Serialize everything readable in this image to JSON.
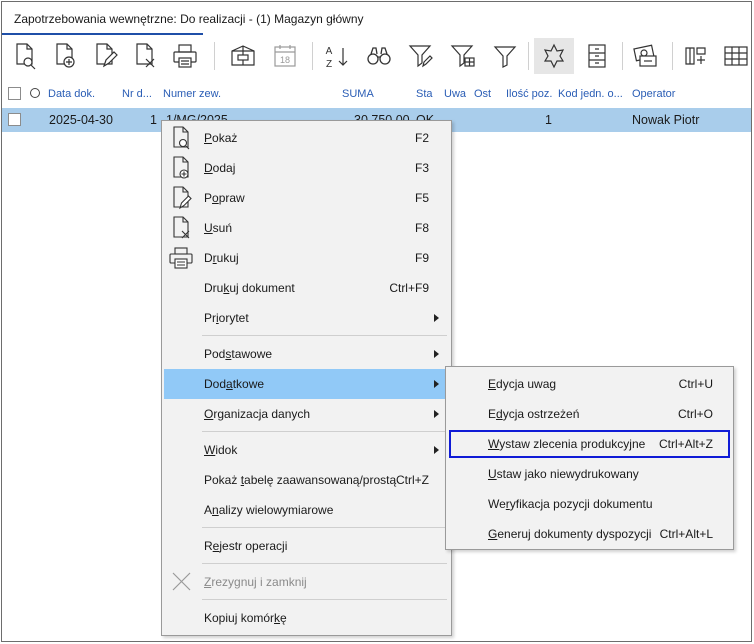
{
  "window": {
    "title": "Zapotrzebowania wewnętrzne: Do realizacji - (1) Magazyn główny"
  },
  "toolbar": {
    "buttons": [
      {
        "name": "show-icon"
      },
      {
        "name": "add-icon"
      },
      {
        "name": "edit-icon"
      },
      {
        "name": "delete-icon"
      },
      {
        "name": "print-icon"
      },
      {
        "name": "package-icon"
      },
      {
        "name": "calendar-icon",
        "calendar_day": "18"
      },
      {
        "name": "sort-az-icon",
        "sort_top": "A",
        "sort_bottom": "Z"
      },
      {
        "name": "binoculars-icon"
      },
      {
        "name": "filter-edit-icon"
      },
      {
        "name": "filter-grid-icon"
      },
      {
        "name": "filter-icon"
      },
      {
        "name": "star-outline-icon"
      },
      {
        "name": "cabinet-icon"
      },
      {
        "name": "money-icon"
      },
      {
        "name": "columns-icon"
      },
      {
        "name": "grid-icon"
      }
    ]
  },
  "grid": {
    "columns": [
      {
        "label": "Data dok."
      },
      {
        "label": "Nr d..."
      },
      {
        "label": "Numer zew."
      },
      {
        "label": "SUMA"
      },
      {
        "label": "Sta"
      },
      {
        "label": "Uwa"
      },
      {
        "label": "Ost"
      },
      {
        "label": "Ilość poz."
      },
      {
        "label": "Kod jedn. o..."
      },
      {
        "label": "Operator"
      }
    ],
    "rows": [
      {
        "date": "2025-04-30",
        "nr": "1",
        "numer_zew": "1/MG/2025",
        "suma": "30 750,00",
        "status": "OK",
        "ilosc": "1",
        "operator": "Nowak Piotr"
      }
    ]
  },
  "context_menu": {
    "items": [
      {
        "pre": "",
        "ul": "P",
        "post": "okaż",
        "shortcut": "F2"
      },
      {
        "pre": "",
        "ul": "D",
        "post": "odaj",
        "shortcut": "F3"
      },
      {
        "pre": "P",
        "ul": "o",
        "post": "praw",
        "shortcut": "F5"
      },
      {
        "pre": "",
        "ul": "U",
        "post": "suń",
        "shortcut": "F8"
      },
      {
        "pre": "D",
        "ul": "r",
        "post": "ukuj",
        "shortcut": "F9"
      },
      {
        "pre": "Dru",
        "ul": "k",
        "post": "uj dokument",
        "shortcut": "Ctrl+F9"
      },
      {
        "pre": "Pr",
        "ul": "i",
        "post": "orytet",
        "shortcut": ""
      },
      {
        "pre": "Pod",
        "ul": "s",
        "post": "tawowe",
        "shortcut": ""
      },
      {
        "pre": "Dod",
        "ul": "a",
        "post": "tkowe",
        "shortcut": ""
      },
      {
        "pre": "",
        "ul": "O",
        "post": "rganizacja danych",
        "shortcut": ""
      },
      {
        "pre": "",
        "ul": "W",
        "post": "idok",
        "shortcut": ""
      },
      {
        "pre": "Pokaż ",
        "ul": "t",
        "post": "abelę zaawansowaną/prostą",
        "shortcut": "Ctrl+Z"
      },
      {
        "pre": "A",
        "ul": "n",
        "post": "alizy wielowymiarowe",
        "shortcut": ""
      },
      {
        "pre": "R",
        "ul": "e",
        "post": "jestr operacji",
        "shortcut": ""
      },
      {
        "pre": "",
        "ul": "Z",
        "post": "rezygnuj i zamknij",
        "shortcut": ""
      },
      {
        "pre": "Kopiuj komór",
        "ul": "k",
        "post": "ę",
        "shortcut": ""
      }
    ]
  },
  "submenu": {
    "items": [
      {
        "pre": "",
        "ul": "E",
        "post": "dycja uwag",
        "shortcut": "Ctrl+U"
      },
      {
        "pre": "E",
        "ul": "d",
        "post": "ycja ostrzeżeń",
        "shortcut": "Ctrl+O"
      },
      {
        "pre": "",
        "ul": "W",
        "post": "ystaw zlecenia produkcyjne",
        "shortcut": "Ctrl+Alt+Z"
      },
      {
        "pre": "",
        "ul": "U",
        "post": "staw jako niewydrukowany",
        "shortcut": ""
      },
      {
        "pre": "We",
        "ul": "r",
        "post": "yfikacja pozycji dokumentu",
        "shortcut": ""
      },
      {
        "pre": "",
        "ul": "G",
        "post": "eneruj dokumenty dyspozycji",
        "shortcut": "Ctrl+Alt+L"
      }
    ]
  },
  "colors": {
    "selection": "#a9cdeb",
    "menu_highlight": "#91c9f7",
    "header_text": "#2a5db5",
    "focus_outline": "#0f1bd6"
  }
}
